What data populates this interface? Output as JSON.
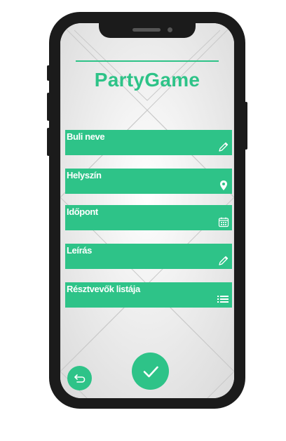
{
  "app": {
    "title": "PartyGame"
  },
  "form": {
    "fields": [
      {
        "label": "Buli neve",
        "icon": "pencil-icon"
      },
      {
        "label": "Helyszín",
        "icon": "location-pin-icon"
      },
      {
        "label": "Időpont",
        "icon": "calendar-icon"
      },
      {
        "label": "Leírás",
        "icon": "pencil-icon"
      },
      {
        "label": "Résztvevők listája",
        "icon": "list-icon"
      }
    ]
  },
  "actions": {
    "back_icon": "back-arrow-icon",
    "confirm_icon": "checkmark-icon"
  },
  "colors": {
    "accent": "#2ec388",
    "phone_frame": "#1b1b1b",
    "screen_bg": "#f2f2f2"
  }
}
